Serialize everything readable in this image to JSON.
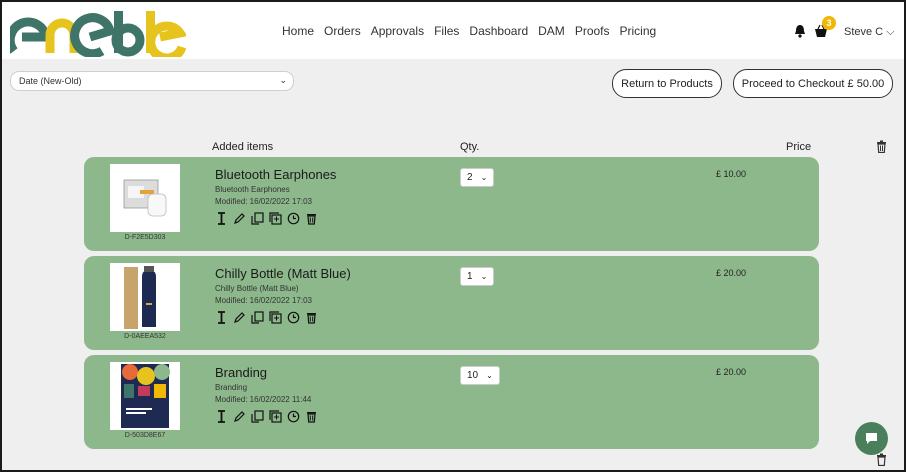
{
  "brand": {
    "logo_text": "enable",
    "colors": [
      "#3f7469",
      "#e6c41d",
      "#3f7469",
      "#3f7469",
      "#e6c41d",
      "#3f7469"
    ]
  },
  "nav": {
    "items": [
      "Home",
      "Orders",
      "Approvals",
      "Files",
      "Dashboard",
      "DAM",
      "Proofs",
      "Pricing"
    ]
  },
  "header_right": {
    "basket_count": "3",
    "user_name": "Steve C"
  },
  "toolbar": {
    "sort_value": "Date (New-Old)",
    "return_label": "Return to Products",
    "checkout_label": "Proceed to Checkout £ 50.00"
  },
  "columns": {
    "items": "Added items",
    "qty": "Qty.",
    "price": "Price"
  },
  "items": [
    {
      "name": "Bluetooth Earphones",
      "subtitle": "Bluetooth Earphones",
      "modified": "Modified: 16/02/2022 17:03",
      "sku": "D-F2E5D303",
      "qty": "2",
      "price": "£ 10.00"
    },
    {
      "name": "Chilly Bottle (Matt Blue)",
      "subtitle": "Chilly Bottle (Matt Blue)",
      "modified": "Modified: 16/02/2022 17:03",
      "sku": "D-0AEEA532",
      "qty": "1",
      "price": "£ 20.00"
    },
    {
      "name": "Branding",
      "subtitle": "Branding",
      "modified": "Modified: 16/02/2022 11:44",
      "sku": "D-503D8E67",
      "qty": "10",
      "price": "£ 20.00"
    }
  ],
  "theme": {
    "row_color": "#8db88b",
    "chat_color": "#4a7f5c",
    "badge_color": "#f2b705"
  }
}
